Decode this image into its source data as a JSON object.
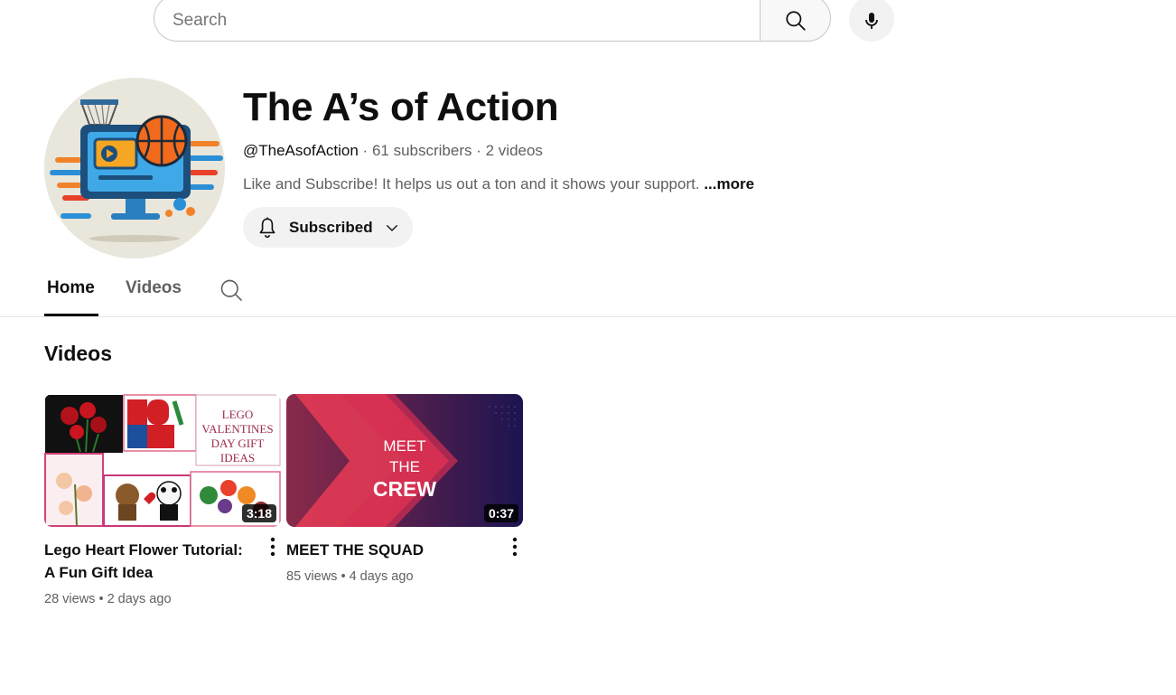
{
  "search": {
    "placeholder": "Search"
  },
  "channel": {
    "name": "The A’s of Action",
    "handle": "@TheAsofAction",
    "subscribers": "61 subscribers",
    "video_count": "2 videos",
    "separator": " · ",
    "description": "Like and Subscribe! It helps us out a ton and it shows your support. ",
    "more_label": "...more",
    "subscribe_label": "Subscribed"
  },
  "tabs": [
    {
      "label": "Home",
      "active": true
    },
    {
      "label": "Videos",
      "active": false
    }
  ],
  "section": {
    "title": "Videos"
  },
  "videos": [
    {
      "title": "Lego Heart Flower Tutorial: A Fun Gift Idea",
      "duration": "3:18",
      "views": "28 views",
      "age": "2 days ago",
      "thumb_text": [
        "LEGO",
        "VALENTINES",
        "DAY GIFT",
        "IDEAS"
      ]
    },
    {
      "title": "MEET THE SQUAD",
      "duration": "0:37",
      "views": "85 views",
      "age": "4 days ago",
      "thumb_text": [
        "MEET",
        "THE",
        "CREW"
      ]
    }
  ],
  "meta_separator": " • ",
  "colors": {
    "text": "#0f0f0f",
    "secondary": "#606060",
    "chip_bg": "#f2f2f2"
  }
}
